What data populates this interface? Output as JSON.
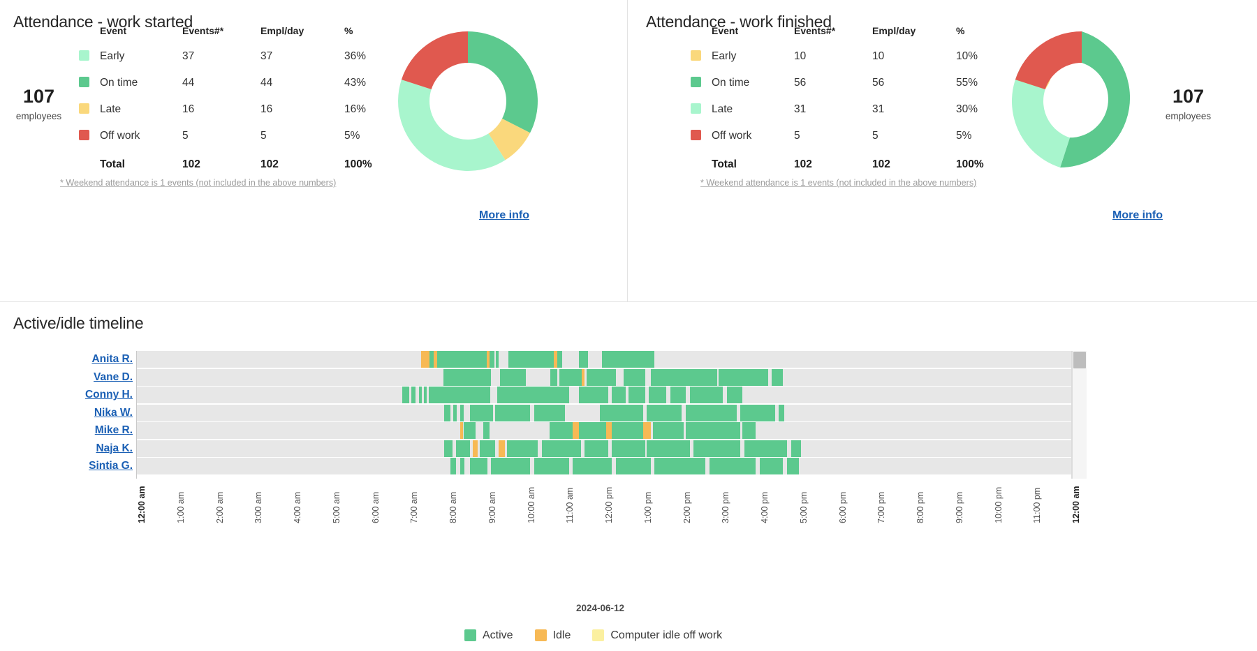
{
  "panels": [
    {
      "title": "Attendance - work started",
      "employees_count": "107",
      "employees_label": "employees",
      "columns": [
        "Event",
        "Events#*",
        "Empl/day",
        "%"
      ],
      "rows": [
        {
          "color": "#a8f5cd",
          "event": "Early",
          "events": "37",
          "empl_day": "37",
          "pct": "36%"
        },
        {
          "color": "#5cc98e",
          "event": "On time",
          "events": "44",
          "empl_day": "44",
          "pct": "43%"
        },
        {
          "color": "#fad87c",
          "event": "Late",
          "events": "16",
          "empl_day": "16",
          "pct": "16%"
        },
        {
          "color": "#e0594f",
          "event": "Off work",
          "events": "5",
          "empl_day": "5",
          "pct": "5%"
        }
      ],
      "total": {
        "event": "Total",
        "events": "102",
        "empl_day": "102",
        "pct": "100%"
      },
      "footnote": "* Weekend attendance is 1 events (not included in the above numbers)",
      "more_info": "More info"
    },
    {
      "title": "Attendance - work finished",
      "employees_count": "107",
      "employees_label": "employees",
      "columns": [
        "Event",
        "Events#*",
        "Empl/day",
        "%"
      ],
      "rows": [
        {
          "color": "#fad87c",
          "event": "Early",
          "events": "10",
          "empl_day": "10",
          "pct": "10%"
        },
        {
          "color": "#5cc98e",
          "event": "On time",
          "events": "56",
          "empl_day": "56",
          "pct": "55%"
        },
        {
          "color": "#a8f5cd",
          "event": "Late",
          "events": "31",
          "empl_day": "31",
          "pct": "30%"
        },
        {
          "color": "#e0594f",
          "event": "Off work",
          "events": "5",
          "empl_day": "5",
          "pct": "5%"
        }
      ],
      "total": {
        "event": "Total",
        "events": "102",
        "empl_day": "102",
        "pct": "100%"
      },
      "footnote": "* Weekend attendance is 1 events (not included in the above numbers)",
      "more_info": "More info"
    }
  ],
  "timeline": {
    "title": "Active/idle timeline",
    "date_label": "2024-06-12",
    "employees": [
      "Anita R.",
      "Vane D.",
      "Conny H.",
      "Nika W.",
      "Mike R.",
      "Naja K.",
      "Sintia G."
    ],
    "axis_ticks": [
      "12:00 am",
      "1:00 am",
      "2:00 am",
      "3:00 am",
      "4:00 am",
      "5:00 am",
      "6:00 am",
      "7:00 am",
      "8:00 am",
      "9:00 am",
      "10:00 am",
      "11:00 am",
      "12:00 pm",
      "1:00 pm",
      "2:00 pm",
      "3:00 pm",
      "4:00 pm",
      "5:00 pm",
      "6:00 pm",
      "7:00 pm",
      "8:00 pm",
      "9:00 pm",
      "10:00 pm",
      "11:00 pm",
      "12:00 am"
    ],
    "legend": [
      {
        "label": "Active",
        "color": "#5cc98e"
      },
      {
        "label": "Idle",
        "color": "#f7b955"
      },
      {
        "label": "Computer idle off work",
        "color": "#fbf0a0"
      }
    ]
  },
  "chart_data": [
    {
      "type": "pie",
      "title": "Attendance - work started",
      "subtitle": "107 employees",
      "categories": [
        "On time",
        "Late",
        "Early",
        "Off work"
      ],
      "values": [
        43,
        16,
        36,
        5
      ],
      "counts": [
        44,
        16,
        37,
        5
      ],
      "colors": [
        "#5cc98e",
        "#fad87c",
        "#a8f5cd",
        "#e0594f"
      ],
      "total_count": 102,
      "total_pct": "100%",
      "donut": true,
      "legend_position": "left-table",
      "note": "* Weekend attendance is 1 events (not included in the above numbers)"
    },
    {
      "type": "pie",
      "title": "Attendance - work finished",
      "subtitle": "107 employees",
      "categories": [
        "On time",
        "Late",
        "Early",
        "Off work"
      ],
      "values": [
        55,
        30,
        10,
        5
      ],
      "counts": [
        56,
        31,
        10,
        5
      ],
      "colors": [
        "#5cc98e",
        "#a8f5cd",
        "#fad87c",
        "#e0594f"
      ],
      "total_count": 102,
      "total_pct": "100%",
      "donut": true,
      "legend_position": "left-table",
      "note": "* Weekend attendance is 1 events (not included in the above numbers)"
    },
    {
      "type": "timeline",
      "title": "Active/idle timeline",
      "xlabel": "2024-06-12",
      "xlim": [
        "12:00 am",
        "12:00 am"
      ],
      "series": [
        {
          "name": "Anita R.",
          "segments": [
            [
              7.3,
              7.52,
              "idle"
            ],
            [
              7.52,
              7.62,
              "active"
            ],
            [
              7.62,
              7.72,
              "idle"
            ],
            [
              7.72,
              7.8,
              "active"
            ],
            [
              7.8,
              8.02,
              "active"
            ],
            [
              8.02,
              8.98,
              "active"
            ],
            [
              8.98,
              9.05,
              "idle"
            ],
            [
              9.05,
              9.18,
              "active"
            ],
            [
              9.22,
              9.3,
              "active"
            ],
            [
              9.55,
              10.7,
              "active"
            ],
            [
              10.7,
              10.8,
              "idle"
            ],
            [
              10.8,
              10.92,
              "active"
            ],
            [
              11.35,
              11.58,
              "active"
            ],
            [
              11.95,
              13.3,
              "active"
            ]
          ]
        },
        {
          "name": "Vane D.",
          "segments": [
            [
              7.88,
              8.2,
              "active"
            ],
            [
              8.2,
              9.1,
              "active"
            ],
            [
              9.32,
              10.0,
              "active"
            ],
            [
              10.62,
              10.8,
              "active"
            ],
            [
              10.85,
              11.42,
              "active"
            ],
            [
              11.42,
              11.5,
              "idle"
            ],
            [
              11.55,
              12.3,
              "active"
            ],
            [
              12.5,
              13.05,
              "active"
            ],
            [
              13.2,
              14.9,
              "active"
            ],
            [
              14.95,
              16.22,
              "active"
            ],
            [
              16.3,
              16.6,
              "active"
            ]
          ]
        },
        {
          "name": "Conny H.",
          "segments": [
            [
              6.82,
              7.0,
              "active"
            ],
            [
              7.05,
              7.15,
              "active"
            ],
            [
              7.25,
              7.32,
              "active"
            ],
            [
              7.38,
              7.45,
              "active"
            ],
            [
              7.5,
              9.08,
              "active"
            ],
            [
              9.25,
              11.1,
              "active"
            ],
            [
              11.35,
              12.1,
              "active"
            ],
            [
              12.2,
              12.55,
              "active"
            ],
            [
              12.62,
              13.05,
              "active"
            ],
            [
              13.15,
              13.6,
              "active"
            ],
            [
              13.7,
              14.1,
              "active"
            ],
            [
              14.2,
              15.05,
              "active"
            ],
            [
              15.15,
              15.55,
              "active"
            ]
          ]
        },
        {
          "name": "Nika W.",
          "segments": [
            [
              7.9,
              8.05,
              "active"
            ],
            [
              8.12,
              8.22,
              "active"
            ],
            [
              8.3,
              8.4,
              "active"
            ],
            [
              8.55,
              9.15,
              "active"
            ],
            [
              9.2,
              10.1,
              "active"
            ],
            [
              10.2,
              11.0,
              "active"
            ],
            [
              11.9,
              13.0,
              "active"
            ],
            [
              13.1,
              14.0,
              "active"
            ],
            [
              14.1,
              15.4,
              "active"
            ],
            [
              15.5,
              16.4,
              "active"
            ],
            [
              16.48,
              16.62,
              "active"
            ]
          ]
        },
        {
          "name": "Mike R.",
          "segments": [
            [
              8.3,
              8.38,
              "idle"
            ],
            [
              8.4,
              8.7,
              "active"
            ],
            [
              8.9,
              9.05,
              "active"
            ],
            [
              10.6,
              11.2,
              "active"
            ],
            [
              11.2,
              11.35,
              "idle"
            ],
            [
              11.35,
              12.05,
              "active"
            ],
            [
              12.05,
              12.2,
              "idle"
            ],
            [
              12.2,
              13.0,
              "active"
            ],
            [
              13.0,
              13.2,
              "idle"
            ],
            [
              13.25,
              14.05,
              "active"
            ],
            [
              14.1,
              15.5,
              "active"
            ],
            [
              15.55,
              15.9,
              "active"
            ]
          ]
        },
        {
          "name": "Naja K.",
          "segments": [
            [
              7.9,
              8.1,
              "active"
            ],
            [
              8.2,
              8.55,
              "active"
            ],
            [
              8.62,
              8.75,
              "idle"
            ],
            [
              8.8,
              9.2,
              "active"
            ],
            [
              9.3,
              9.45,
              "idle"
            ],
            [
              9.5,
              10.3,
              "active"
            ],
            [
              10.4,
              11.4,
              "active"
            ],
            [
              11.5,
              12.1,
              "active"
            ],
            [
              12.2,
              13.05,
              "active"
            ],
            [
              13.1,
              14.2,
              "active"
            ],
            [
              14.3,
              15.5,
              "active"
            ],
            [
              15.6,
              16.7,
              "active"
            ],
            [
              16.8,
              17.05,
              "active"
            ]
          ]
        },
        {
          "name": "Sintia G.",
          "segments": [
            [
              8.05,
              8.2,
              "active"
            ],
            [
              8.3,
              8.42,
              "active"
            ],
            [
              8.55,
              9.0,
              "active"
            ],
            [
              9.1,
              10.1,
              "active"
            ],
            [
              10.2,
              11.1,
              "active"
            ],
            [
              11.2,
              12.2,
              "active"
            ],
            [
              12.3,
              13.2,
              "active"
            ],
            [
              13.3,
              14.6,
              "active"
            ],
            [
              14.7,
              15.9,
              "active"
            ],
            [
              16.0,
              16.6,
              "active"
            ],
            [
              16.7,
              17.0,
              "active"
            ]
          ]
        }
      ],
      "legend": [
        "Active",
        "Idle",
        "Computer idle off work"
      ]
    }
  ]
}
